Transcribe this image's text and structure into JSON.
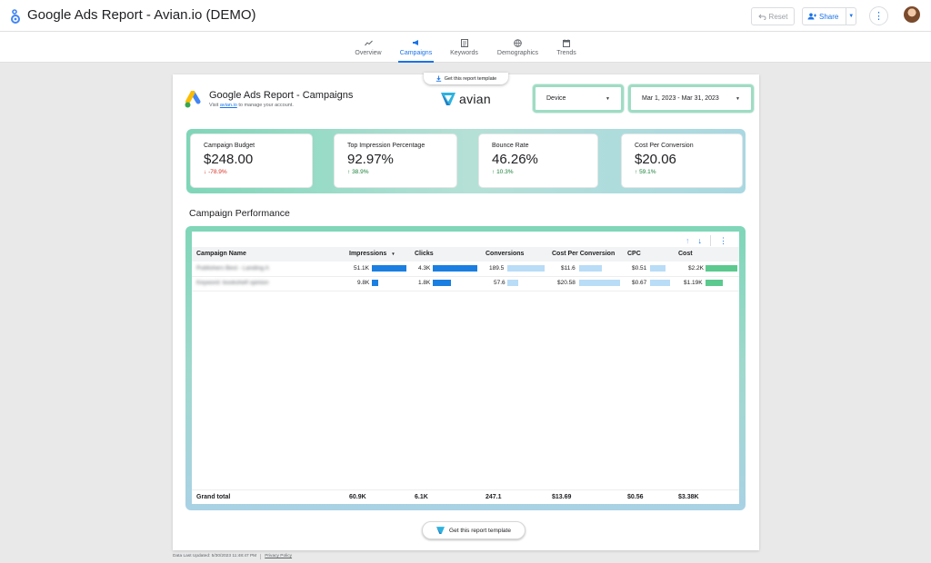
{
  "app": {
    "title": "Google Ads Report - Avian.io (DEMO)",
    "reset_label": "Reset",
    "share_label": "Share"
  },
  "tabs": [
    {
      "label": "Overview",
      "icon": "trend-icon",
      "active": false
    },
    {
      "label": "Campaigns",
      "icon": "megaphone-icon",
      "active": true
    },
    {
      "label": "Keywords",
      "icon": "document-icon",
      "active": false
    },
    {
      "label": "Demographics",
      "icon": "globe-icon",
      "active": false
    },
    {
      "label": "Trends",
      "icon": "calendar-icon",
      "active": false
    }
  ],
  "report": {
    "get_template_label": "Get this report template",
    "title": "Google Ads Report - Campaigns",
    "sub_prefix": "Visit",
    "sub_link": "avian.io",
    "sub_suffix": "to manage your account.",
    "brand": "avian",
    "device_filter": "Device",
    "date_range": "Mar 1, 2023 - Mar 31, 2023"
  },
  "kpis": [
    {
      "label": "Campaign Budget",
      "value": "$248.00",
      "delta": "-78.9%",
      "direction": "down"
    },
    {
      "label": "Top Impression Percentage",
      "value": "92.97%",
      "delta": "38.9%",
      "direction": "up"
    },
    {
      "label": "Bounce Rate",
      "value": "46.26%",
      "delta": "10.3%",
      "direction": "up"
    },
    {
      "label": "Cost Per Conversion",
      "value": "$20.06",
      "delta": "59.1%",
      "direction": "up"
    }
  ],
  "section_title": "Campaign Performance",
  "table": {
    "columns": [
      "Campaign Name",
      "Impressions",
      "Clicks",
      "Conversions",
      "Cost Per Conversion",
      "CPC",
      "Cost"
    ],
    "sort_indicator": "▼",
    "rows": [
      {
        "name": "Publishers Best - Landing A",
        "impressions": "51.1K",
        "clicks": "4.3K",
        "conversions": "189.5",
        "cpc_conv": "$11.6",
        "cpc": "$0.51",
        "cost": "$2.2K"
      },
      {
        "name": "Keyword: bookshelf opinion",
        "impressions": "9.8K",
        "clicks": "1.8K",
        "conversions": "57.6",
        "cpc_conv": "$20.58",
        "cpc": "$0.67",
        "cost": "$1.19K"
      }
    ],
    "bar_fractions": {
      "impressions": [
        1.0,
        0.19
      ],
      "clicks": [
        1.0,
        0.41
      ],
      "conversions": [
        1.0,
        0.3
      ],
      "cpc_conv": [
        0.56,
        1.0
      ],
      "cpc": [
        0.76,
        1.0
      ],
      "cost": [
        1.0,
        0.54
      ]
    },
    "grand_total": {
      "label": "Grand total",
      "impressions": "60.9K",
      "clicks": "6.1K",
      "conversions": "247.1",
      "cpc_conv": "$13.69",
      "cpc": "$0.56",
      "cost": "$3.38K"
    }
  },
  "footer": {
    "updated": "Data Last Updated: 5/30/2023 11:48:47 PM",
    "privacy": "Privacy Policy"
  },
  "colors": {
    "accent": "#1a73e8",
    "bar_strong": "#1a7fe0",
    "bar_light": "#b9dcf7",
    "bar_green": "#5cc98f",
    "down": "#d93025",
    "up": "#188038"
  }
}
